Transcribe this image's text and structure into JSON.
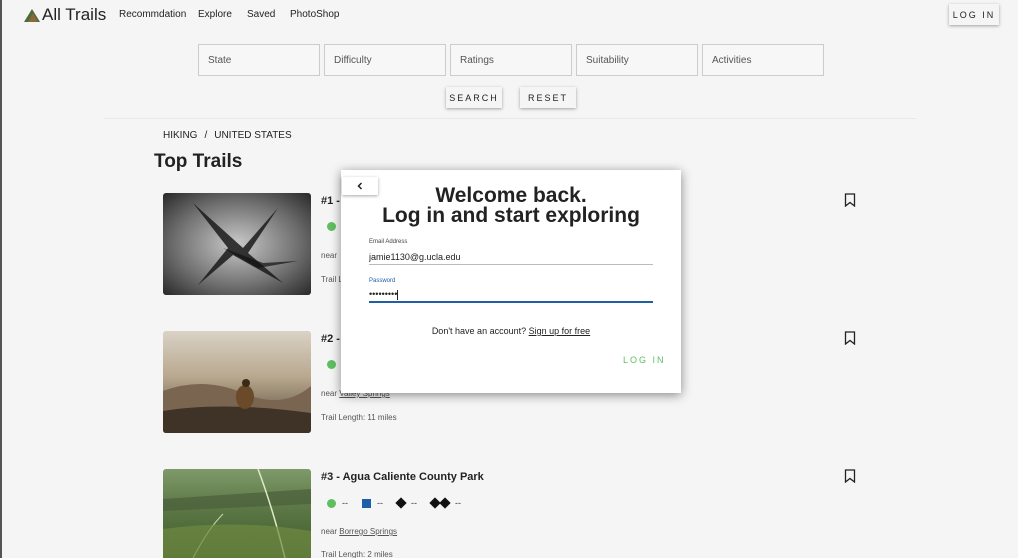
{
  "header": {
    "brand": "All Trails",
    "nav": [
      "Recommdation",
      "Explore",
      "Saved",
      "PhotoShop"
    ],
    "login_label": "LOG IN"
  },
  "filters": {
    "state_placeholder": "State",
    "difficulty_placeholder": "Difficulty",
    "ratings_placeholder": "Ratings",
    "suitability_placeholder": "Suitability",
    "activities_placeholder": "Activities",
    "search_label": "SEARCH",
    "reset_label": "RESET"
  },
  "breadcrumb": {
    "first": "HIKING",
    "separator": "/",
    "second": "UNITED STATES"
  },
  "page_title": "Top Trails",
  "trails": [
    {
      "title": "#1 - ",
      "near_prefix": "near ",
      "near_place": "",
      "length": "Trail L",
      "stats": []
    },
    {
      "title": "#2 - ",
      "near_prefix": "near ",
      "near_place": "Valley Springs",
      "length": "Trail Length: 11 miles",
      "stats": []
    },
    {
      "title": "#3 - Agua Caliente County Park",
      "near_prefix": "near ",
      "near_place": "Borrego Springs",
      "length": "Trail Length: 2 miles",
      "stats": [
        "--",
        "--",
        "--",
        "--"
      ]
    }
  ],
  "modal": {
    "title_line1": "Welcome back.",
    "title_line2": "Log in and start exploring",
    "email_label": "Email Address",
    "email_value": "jamie1130@g.ucla.edu",
    "password_label": "Password",
    "password_value": "•••••••••",
    "signup_text": "Don't have an account?",
    "signup_link": "Sign up for free",
    "login_label": "LOG IN"
  },
  "colors": {
    "accent_green": "#5fbf5f",
    "accent_blue": "#1e5fa8"
  }
}
